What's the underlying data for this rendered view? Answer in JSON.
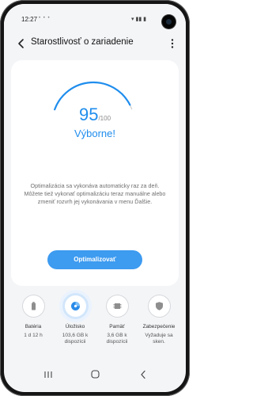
{
  "status_bar": {
    "time": "12:27",
    "notification_dots": "• • •",
    "indicators": "▾ ▮▮ ▮"
  },
  "header": {
    "title": "Starostlivosť o zariadenie"
  },
  "score": {
    "value": 95,
    "max_label": "/100",
    "fraction": 0.95,
    "rating": "Výborne!"
  },
  "description": "Optimalizácia sa vykonáva automaticky raz za deň. Môžete tiež vykonať optimalizáciu teraz manuálne alebo zmeniť rozvrh jej vykonávania v menu Ďalšie.",
  "actions": {
    "optimize_label": "Optimalizovať"
  },
  "categories": [
    {
      "name": "Batéria",
      "info": "1 d 12 h",
      "icon": "battery-icon"
    },
    {
      "name": "Úložisko",
      "info": "103,6 GB k dispozícii",
      "icon": "storage-icon",
      "active": true
    },
    {
      "name": "Pamäť",
      "info": "3,6 GB k dispozícii",
      "icon": "memory-icon"
    },
    {
      "name": "Zabezpečenie",
      "info": "Vyžaduje sa sken.",
      "icon": "shield-icon"
    }
  ],
  "colors": {
    "accent": "#1f8ded",
    "button": "#3d9bf0",
    "gauge_track": "#c9c9c9",
    "background": "#f4f5f7"
  }
}
